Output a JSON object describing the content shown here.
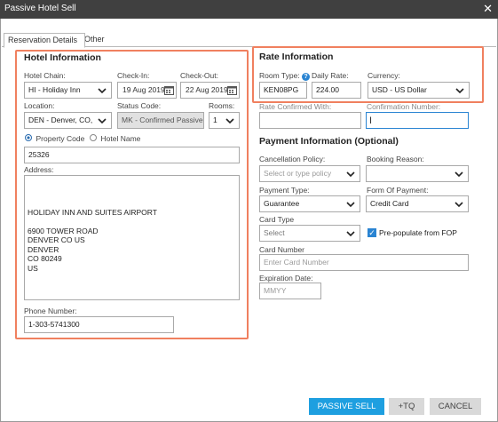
{
  "window": {
    "title": "Passive Hotel Sell"
  },
  "tabs": [
    {
      "label": "Reservation Details"
    },
    {
      "label": "Other"
    }
  ],
  "hotel": {
    "heading": "Hotel Information",
    "chain_label": "Hotel Chain:",
    "chain_value": "HI - Holiday Inn",
    "checkin_label": "Check-In:",
    "checkin_value": "19 Aug 2019",
    "checkout_label": "Check-Out:",
    "checkout_value": "22 Aug 2019",
    "location_label": "Location:",
    "location_value": "DEN - Denver, CO, U",
    "status_label": "Status Code:",
    "status_value": "MK - Confirmed Passive",
    "rooms_label": "Rooms:",
    "rooms_value": "1",
    "radio_property": "Property Code",
    "radio_name": "Hotel Name",
    "property_code": "25326",
    "address_label": "Address:",
    "address_lines": "\n\n\nHOLIDAY INN AND SUITES AIRPORT\n\n6900 TOWER ROAD\nDENVER CO US\nDENVER\nCO 80249\nUS",
    "phone_label": "Phone Number:",
    "phone_value": "1-303-5741300"
  },
  "rate": {
    "heading": "Rate Information",
    "room_type_label": "Room Type:",
    "room_type_value": "KEN08PG",
    "daily_rate_label": "Daily Rate:",
    "daily_rate_value": "224.00",
    "currency_label": "Currency:",
    "currency_value": "USD - US Dollar",
    "rate_confirmed_label": "Rate Confirmed With:",
    "confirmation_label": "Confirmation Number:"
  },
  "payment": {
    "heading": "Payment Information (Optional)",
    "cancel_label": "Cancellation Policy:",
    "cancel_placeholder": "Select or type policy",
    "booking_label": "Booking Reason:",
    "payment_type_label": "Payment Type:",
    "payment_type_value": "Guarantee",
    "fop_label": "Form Of Payment:",
    "fop_value": "Credit Card",
    "card_type_label": "Card Type",
    "card_type_value": "Select",
    "prepopulate_label": "Pre-populate from FOP",
    "card_number_label": "Card Number",
    "card_number_placeholder": "Enter Card Number",
    "expiration_label": "Expiration Date:",
    "expiration_placeholder": "MMYY"
  },
  "footer": {
    "passive_sell": "PASSIVE SELL",
    "tq": "+TQ",
    "cancel": "CANCEL"
  },
  "colors": {
    "accent": "#1e9fe0",
    "highlight": "#f0805f",
    "titlebar": "#404040"
  }
}
